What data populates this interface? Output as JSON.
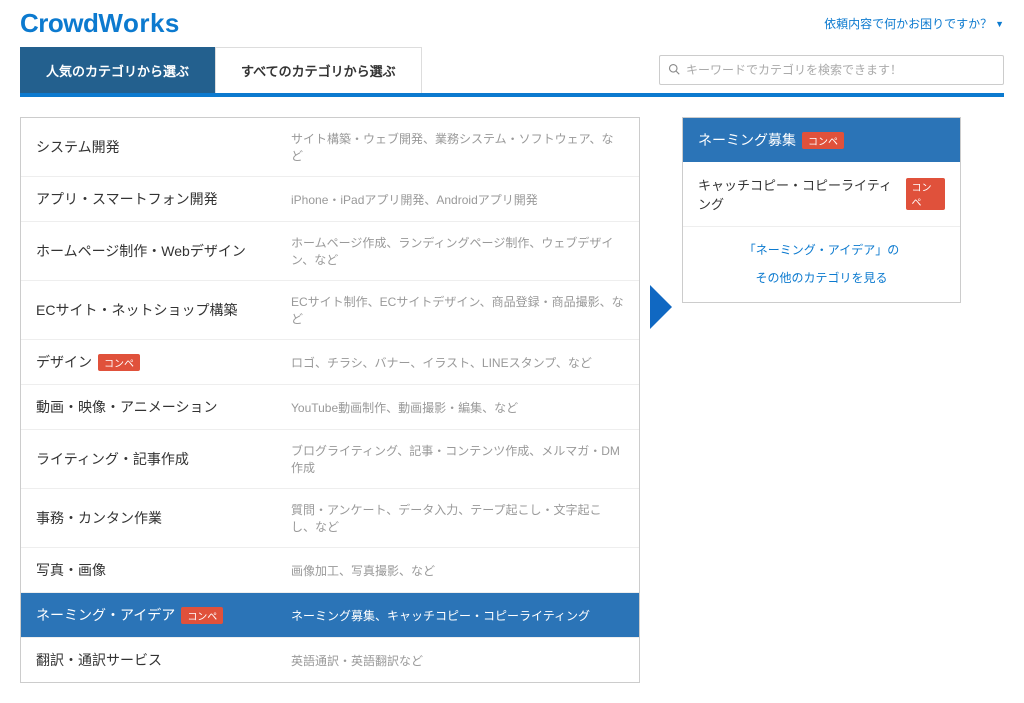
{
  "header": {
    "logo_crowd": "Crowd",
    "logo_works": "Works",
    "help_link": "依頼内容で何かお困りですか？"
  },
  "tabs": {
    "active": "人気のカテゴリから選ぶ",
    "all": "すべてのカテゴリから選ぶ"
  },
  "search": {
    "placeholder": "キーワードでカテゴリを検索できます！"
  },
  "categories": [
    {
      "title": "システム開発",
      "desc": "サイト構築・ウェブ開発、業務システム・ソフトウェア、など",
      "badge": null,
      "selected": false
    },
    {
      "title": "アプリ・スマートフォン開発",
      "desc": "iPhone・iPadアプリ開発、Androidアプリ開発",
      "badge": null,
      "selected": false
    },
    {
      "title": "ホームページ制作・Webデザイン",
      "desc": "ホームページ作成、ランディングページ制作、ウェブデザイン、など",
      "badge": null,
      "selected": false
    },
    {
      "title": "ECサイト・ネットショップ構築",
      "desc": "ECサイト制作、ECサイトデザイン、商品登録・商品撮影、など",
      "badge": null,
      "selected": false
    },
    {
      "title": "デザイン",
      "desc": "ロゴ、チラシ、バナー、イラスト、LINEスタンプ、など",
      "badge": "コンペ",
      "selected": false
    },
    {
      "title": "動画・映像・アニメーション",
      "desc": "YouTube動画制作、動画撮影・編集、など",
      "badge": null,
      "selected": false
    },
    {
      "title": "ライティング・記事作成",
      "desc": "ブログライティング、記事・コンテンツ作成、メルマガ・DM作成",
      "badge": null,
      "selected": false
    },
    {
      "title": "事務・カンタン作業",
      "desc": "質問・アンケート、データ入力、テープ起こし・文字起こし、など",
      "badge": null,
      "selected": false
    },
    {
      "title": "写真・画像",
      "desc": "画像加工、写真撮影、など",
      "badge": null,
      "selected": false
    },
    {
      "title": "ネーミング・アイデア",
      "desc": "ネーミング募集、キャッチコピー・コピーライティング",
      "badge": "コンペ",
      "selected": true
    },
    {
      "title": "翻訳・通訳サービス",
      "desc": "英語通訳・英語翻訳など",
      "badge": null,
      "selected": false
    }
  ],
  "detail": {
    "header": "ネーミング募集",
    "header_badge": "コンペ",
    "items": [
      {
        "label": "キャッチコピー・コピーライティング",
        "badge": "コンペ"
      }
    ],
    "more_link_line1": "「ネーミング・アイデア」の",
    "more_link_line2": "その他のカテゴリを見る"
  }
}
